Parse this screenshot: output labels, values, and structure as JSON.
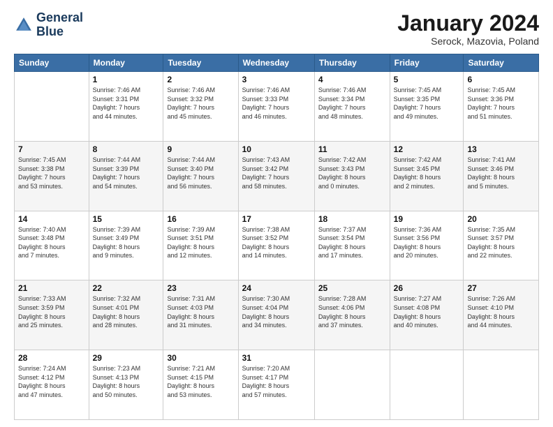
{
  "header": {
    "title": "January 2024",
    "subtitle": "Serock, Mazovia, Poland",
    "logo_line1": "General",
    "logo_line2": "Blue"
  },
  "weekdays": [
    "Sunday",
    "Monday",
    "Tuesday",
    "Wednesday",
    "Thursday",
    "Friday",
    "Saturday"
  ],
  "weeks": [
    [
      {
        "day": "",
        "info": ""
      },
      {
        "day": "1",
        "info": "Sunrise: 7:46 AM\nSunset: 3:31 PM\nDaylight: 7 hours\nand 44 minutes."
      },
      {
        "day": "2",
        "info": "Sunrise: 7:46 AM\nSunset: 3:32 PM\nDaylight: 7 hours\nand 45 minutes."
      },
      {
        "day": "3",
        "info": "Sunrise: 7:46 AM\nSunset: 3:33 PM\nDaylight: 7 hours\nand 46 minutes."
      },
      {
        "day": "4",
        "info": "Sunrise: 7:46 AM\nSunset: 3:34 PM\nDaylight: 7 hours\nand 48 minutes."
      },
      {
        "day": "5",
        "info": "Sunrise: 7:45 AM\nSunset: 3:35 PM\nDaylight: 7 hours\nand 49 minutes."
      },
      {
        "day": "6",
        "info": "Sunrise: 7:45 AM\nSunset: 3:36 PM\nDaylight: 7 hours\nand 51 minutes."
      }
    ],
    [
      {
        "day": "7",
        "info": "Sunrise: 7:45 AM\nSunset: 3:38 PM\nDaylight: 7 hours\nand 53 minutes."
      },
      {
        "day": "8",
        "info": "Sunrise: 7:44 AM\nSunset: 3:39 PM\nDaylight: 7 hours\nand 54 minutes."
      },
      {
        "day": "9",
        "info": "Sunrise: 7:44 AM\nSunset: 3:40 PM\nDaylight: 7 hours\nand 56 minutes."
      },
      {
        "day": "10",
        "info": "Sunrise: 7:43 AM\nSunset: 3:42 PM\nDaylight: 7 hours\nand 58 minutes."
      },
      {
        "day": "11",
        "info": "Sunrise: 7:42 AM\nSunset: 3:43 PM\nDaylight: 8 hours\nand 0 minutes."
      },
      {
        "day": "12",
        "info": "Sunrise: 7:42 AM\nSunset: 3:45 PM\nDaylight: 8 hours\nand 2 minutes."
      },
      {
        "day": "13",
        "info": "Sunrise: 7:41 AM\nSunset: 3:46 PM\nDaylight: 8 hours\nand 5 minutes."
      }
    ],
    [
      {
        "day": "14",
        "info": "Sunrise: 7:40 AM\nSunset: 3:48 PM\nDaylight: 8 hours\nand 7 minutes."
      },
      {
        "day": "15",
        "info": "Sunrise: 7:39 AM\nSunset: 3:49 PM\nDaylight: 8 hours\nand 9 minutes."
      },
      {
        "day": "16",
        "info": "Sunrise: 7:39 AM\nSunset: 3:51 PM\nDaylight: 8 hours\nand 12 minutes."
      },
      {
        "day": "17",
        "info": "Sunrise: 7:38 AM\nSunset: 3:52 PM\nDaylight: 8 hours\nand 14 minutes."
      },
      {
        "day": "18",
        "info": "Sunrise: 7:37 AM\nSunset: 3:54 PM\nDaylight: 8 hours\nand 17 minutes."
      },
      {
        "day": "19",
        "info": "Sunrise: 7:36 AM\nSunset: 3:56 PM\nDaylight: 8 hours\nand 20 minutes."
      },
      {
        "day": "20",
        "info": "Sunrise: 7:35 AM\nSunset: 3:57 PM\nDaylight: 8 hours\nand 22 minutes."
      }
    ],
    [
      {
        "day": "21",
        "info": "Sunrise: 7:33 AM\nSunset: 3:59 PM\nDaylight: 8 hours\nand 25 minutes."
      },
      {
        "day": "22",
        "info": "Sunrise: 7:32 AM\nSunset: 4:01 PM\nDaylight: 8 hours\nand 28 minutes."
      },
      {
        "day": "23",
        "info": "Sunrise: 7:31 AM\nSunset: 4:03 PM\nDaylight: 8 hours\nand 31 minutes."
      },
      {
        "day": "24",
        "info": "Sunrise: 7:30 AM\nSunset: 4:04 PM\nDaylight: 8 hours\nand 34 minutes."
      },
      {
        "day": "25",
        "info": "Sunrise: 7:28 AM\nSunset: 4:06 PM\nDaylight: 8 hours\nand 37 minutes."
      },
      {
        "day": "26",
        "info": "Sunrise: 7:27 AM\nSunset: 4:08 PM\nDaylight: 8 hours\nand 40 minutes."
      },
      {
        "day": "27",
        "info": "Sunrise: 7:26 AM\nSunset: 4:10 PM\nDaylight: 8 hours\nand 44 minutes."
      }
    ],
    [
      {
        "day": "28",
        "info": "Sunrise: 7:24 AM\nSunset: 4:12 PM\nDaylight: 8 hours\nand 47 minutes."
      },
      {
        "day": "29",
        "info": "Sunrise: 7:23 AM\nSunset: 4:13 PM\nDaylight: 8 hours\nand 50 minutes."
      },
      {
        "day": "30",
        "info": "Sunrise: 7:21 AM\nSunset: 4:15 PM\nDaylight: 8 hours\nand 53 minutes."
      },
      {
        "day": "31",
        "info": "Sunrise: 7:20 AM\nSunset: 4:17 PM\nDaylight: 8 hours\nand 57 minutes."
      },
      {
        "day": "",
        "info": ""
      },
      {
        "day": "",
        "info": ""
      },
      {
        "day": "",
        "info": ""
      }
    ]
  ]
}
